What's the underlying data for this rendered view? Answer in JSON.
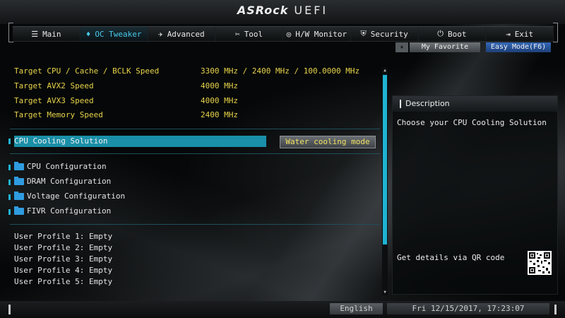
{
  "logo": {
    "brand": "ASRock",
    "product": "UEFI"
  },
  "nav": {
    "tabs": [
      {
        "label": "Main",
        "icon": "main-icon",
        "glyph": "☰"
      },
      {
        "label": "OC Tweaker",
        "icon": "oc-tweaker-icon",
        "glyph": "♦"
      },
      {
        "label": "Advanced",
        "icon": "advanced-icon",
        "glyph": "✈"
      },
      {
        "label": "Tool",
        "icon": "tool-icon",
        "glyph": "✂"
      },
      {
        "label": "H/W Monitor",
        "icon": "monitor-icon",
        "glyph": "◎"
      },
      {
        "label": "Security",
        "icon": "security-icon",
        "glyph": "⛨"
      },
      {
        "label": "Boot",
        "icon": "power-icon",
        "glyph": "⏻"
      },
      {
        "label": "Exit",
        "icon": "exit-icon",
        "glyph": "⇥"
      }
    ],
    "active": "OC Tweaker"
  },
  "buttons": {
    "favorite": "My Favorite",
    "easy_mode": "Easy Mode(F6)",
    "language": "English"
  },
  "info": [
    {
      "label": "Target CPU / Cache / BCLK Speed",
      "value": "3300 MHz / 2400 MHz / 100.0000 MHz"
    },
    {
      "label": "Target AVX2 Speed",
      "value": "4000 MHz"
    },
    {
      "label": "Target AVX3 Speed",
      "value": "4000 MHz"
    },
    {
      "label": "Target Memory Speed",
      "value": "2400 MHz"
    }
  ],
  "selected": {
    "label": "CPU Cooling Solution",
    "value": "Water cooling mode"
  },
  "submenus": [
    "CPU Configuration",
    "DRAM Configuration",
    "Voltage Configuration",
    "FIVR Configuration"
  ],
  "profiles": [
    "User Profile 1: Empty",
    "User Profile 2: Empty",
    "User Profile 3: Empty",
    "User Profile 4: Empty",
    "User Profile 5: Empty"
  ],
  "description": {
    "title": "Description",
    "text": "Choose your CPU Cooling Solution",
    "qr_text": "Get details via QR code"
  },
  "datetime": "Fri 12/15/2017, 17:23:07",
  "colors": {
    "accent": "#1fb3d3",
    "highlight": "#1a8fa8",
    "value_yellow": "#e8d44a",
    "easy_mode": "#2b58a0"
  }
}
